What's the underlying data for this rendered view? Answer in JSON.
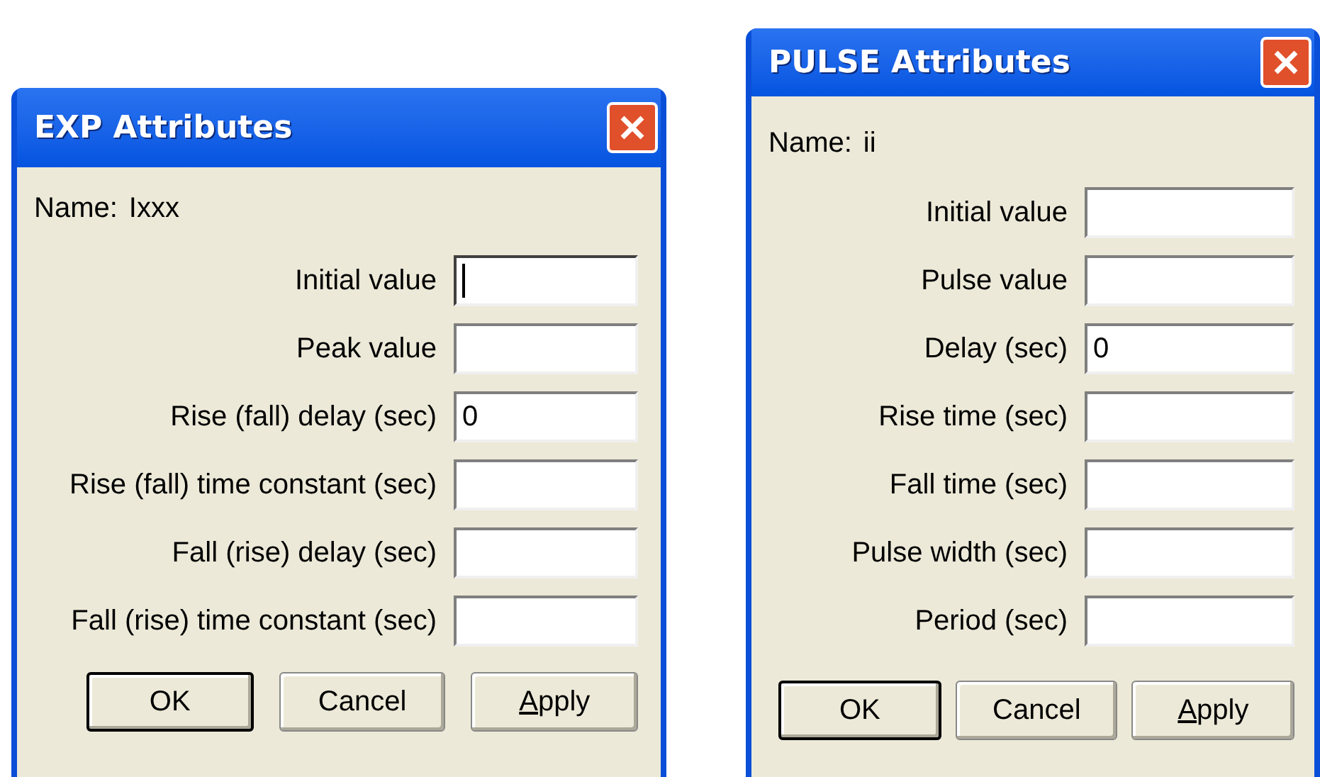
{
  "dialogs": [
    {
      "title": "EXP Attributes",
      "name_label": "Name:",
      "name_value": "Ixxx",
      "fields": [
        {
          "label": "Initial value",
          "focused": true
        },
        {
          "label": "Peak value",
          "focused": false
        },
        {
          "label": "Rise (fall) delay (sec)",
          "value": "0",
          "focused": false
        },
        {
          "label": "Rise (fall) time constant (sec)",
          "focused": false
        },
        {
          "label": "Fall (rise) delay (sec)",
          "focused": false
        },
        {
          "label": "Fall (rise) time constant (sec)",
          "focused": false
        }
      ],
      "buttons": [
        {
          "label": "OK",
          "default": true,
          "mnemonic": false
        },
        {
          "label": "Cancel",
          "default": false,
          "mnemonic": false
        },
        {
          "label": "Apply",
          "default": false,
          "mnemonic": true
        }
      ]
    },
    {
      "title": "PULSE Attributes",
      "name_label": "Name:",
      "name_value": "ii",
      "fields": [
        {
          "label": "Initial value",
          "focused": false
        },
        {
          "label": "Pulse value",
          "focused": false
        },
        {
          "label": "Delay (sec)",
          "value": "0",
          "focused": false
        },
        {
          "label": "Rise time (sec)",
          "focused": false
        },
        {
          "label": "Fall time (sec)",
          "focused": false
        },
        {
          "label": "Pulse width (sec)",
          "focused": false
        },
        {
          "label": "Period (sec)",
          "focused": false
        }
      ],
      "buttons": [
        {
          "label": "OK",
          "default": true,
          "mnemonic": false
        },
        {
          "label": "Cancel",
          "default": false,
          "mnemonic": false
        },
        {
          "label": "Apply",
          "default": false,
          "mnemonic": true
        }
      ]
    }
  ]
}
